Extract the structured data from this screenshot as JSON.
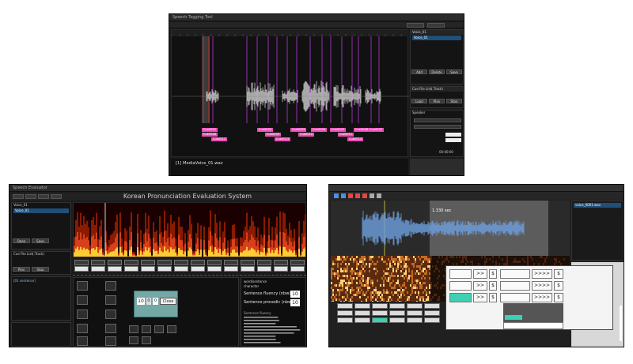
{
  "window1": {
    "title": "Speech Tagging Tool",
    "cue_labels_row1": [
      "Cue0001",
      "Cue0002",
      "Cue0003",
      "Cue0004",
      "Cue0005",
      "Cue0006",
      "Cue0007"
    ],
    "cue_labels_row2": [
      "Cue0008",
      "Cue0009",
      "Cue0010",
      "Cue0011"
    ],
    "cue_labels_row3": [
      "Cue0012",
      "Cue0013",
      "Cue0014"
    ],
    "sidebar": {
      "list_title": "Voice_01",
      "selected_item": "Voice_01",
      "cue_list_title": "Cue File List(.Track)",
      "speaker_label": "Speaker",
      "buttons": [
        "Add",
        "Delete",
        "Save",
        "Load",
        "Play",
        "Stop"
      ],
      "time_readout": "00:00:00"
    },
    "transcript_line1": "[1] MediaVoice_01.wav",
    "transcript_line2": ""
  },
  "window2": {
    "title": "Korean Pronunciation Evaluation System",
    "app_title": "Speech Evaluator",
    "left_panel": {
      "list_title": "Voice_01",
      "list_item": "Voice_01",
      "cue_list_title": "Cue File List(.Track)",
      "buttons": [
        "Open",
        "Save",
        "Play",
        "Stop"
      ],
      "info_title": "[01 sentence]"
    },
    "score_panel": {
      "sentence_fluency_label": "Sentence fluency (nbw)",
      "sentence_fluency_value": "10",
      "sentence_prosodic_label": "Sentence prosodic (nbw)",
      "sentence_prosodic_value": "10",
      "word_label": "word/sentence",
      "character_label": "character",
      "notes_title": "Sentence fluency"
    },
    "dialog": {
      "prompt": "",
      "field1": "10",
      "field2": "0",
      "field3": "0",
      "close_label": "Close",
      "notes": [
        "",
        "",
        ""
      ]
    }
  },
  "window3": {
    "title": "",
    "duration_label": "1.330 sec",
    "list_item": "voice_0001.wav",
    "rows": [
      {
        "a": "",
        "b": ">>",
        "c": "$",
        "d": "",
        "e": ">>>>",
        "f": "$"
      },
      {
        "a": "",
        "b": ">>",
        "c": "$",
        "d": "",
        "e": ">>>>",
        "f": "$"
      },
      {
        "a": "",
        "b": ">>",
        "c": "$",
        "d": "",
        "e": ">>>>",
        "f": "$"
      }
    ],
    "bottom_button": ""
  }
}
